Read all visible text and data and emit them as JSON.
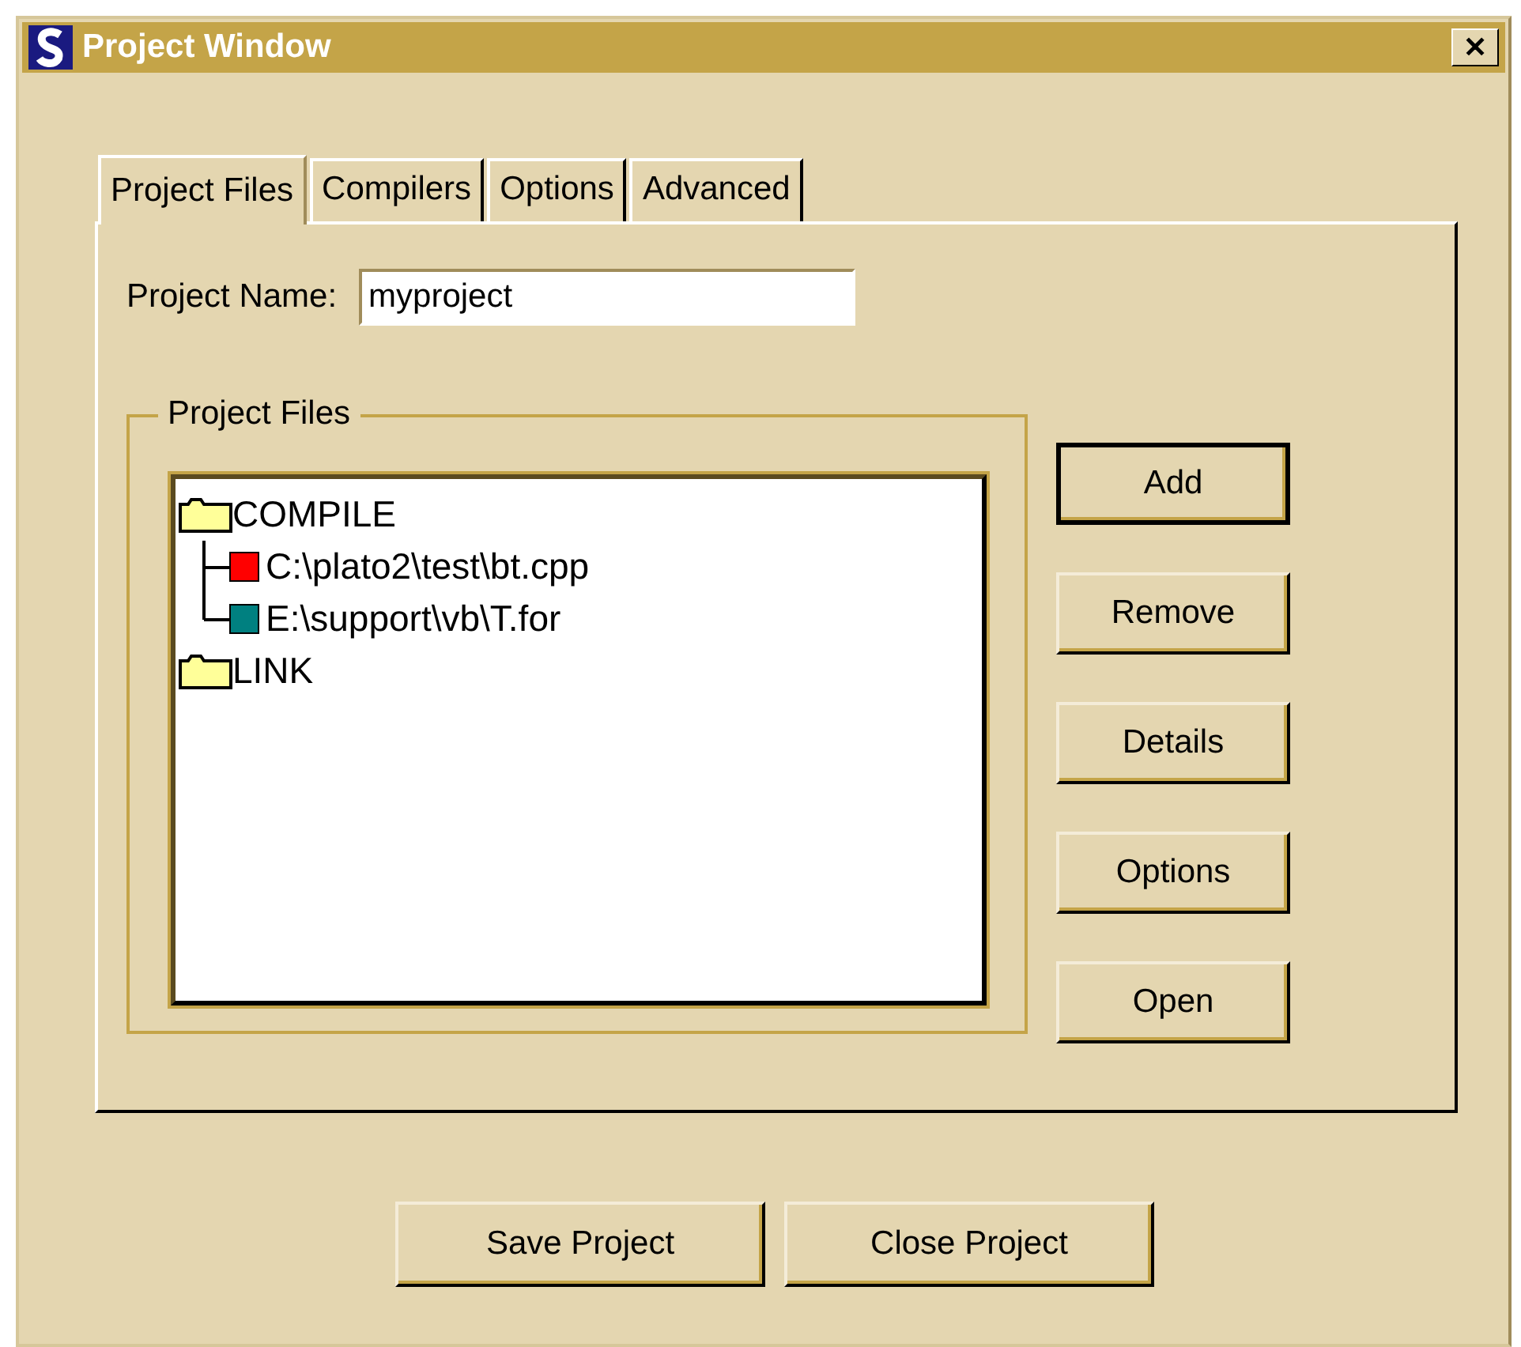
{
  "window": {
    "title": "Project Window",
    "close": "✕"
  },
  "tabs": [
    {
      "label": "Project Files",
      "selected": true
    },
    {
      "label": "Compilers",
      "selected": false
    },
    {
      "label": "Options",
      "selected": false
    },
    {
      "label": "Advanced",
      "selected": false
    }
  ],
  "project_name": {
    "label": "Project Name:",
    "value": "myproject"
  },
  "group": {
    "title": "Project Files"
  },
  "tree": [
    {
      "kind": "folder",
      "label": "COMPILE",
      "children": [
        {
          "kind": "file",
          "label": "C:\\plato2\\test\\bt.cpp",
          "color": "#ff0000"
        },
        {
          "kind": "file",
          "label": "E:\\support\\vb\\T.for",
          "color": "#008080"
        }
      ]
    },
    {
      "kind": "folder",
      "label": "LINK"
    }
  ],
  "side_buttons": [
    {
      "label": "Add",
      "default": true
    },
    {
      "label": "Remove",
      "default": false
    },
    {
      "label": "Details",
      "default": false
    },
    {
      "label": "Options",
      "default": false
    },
    {
      "label": "Open",
      "default": false
    }
  ],
  "bottom_buttons": [
    {
      "label": "Save Project"
    },
    {
      "label": "Close Project"
    }
  ]
}
